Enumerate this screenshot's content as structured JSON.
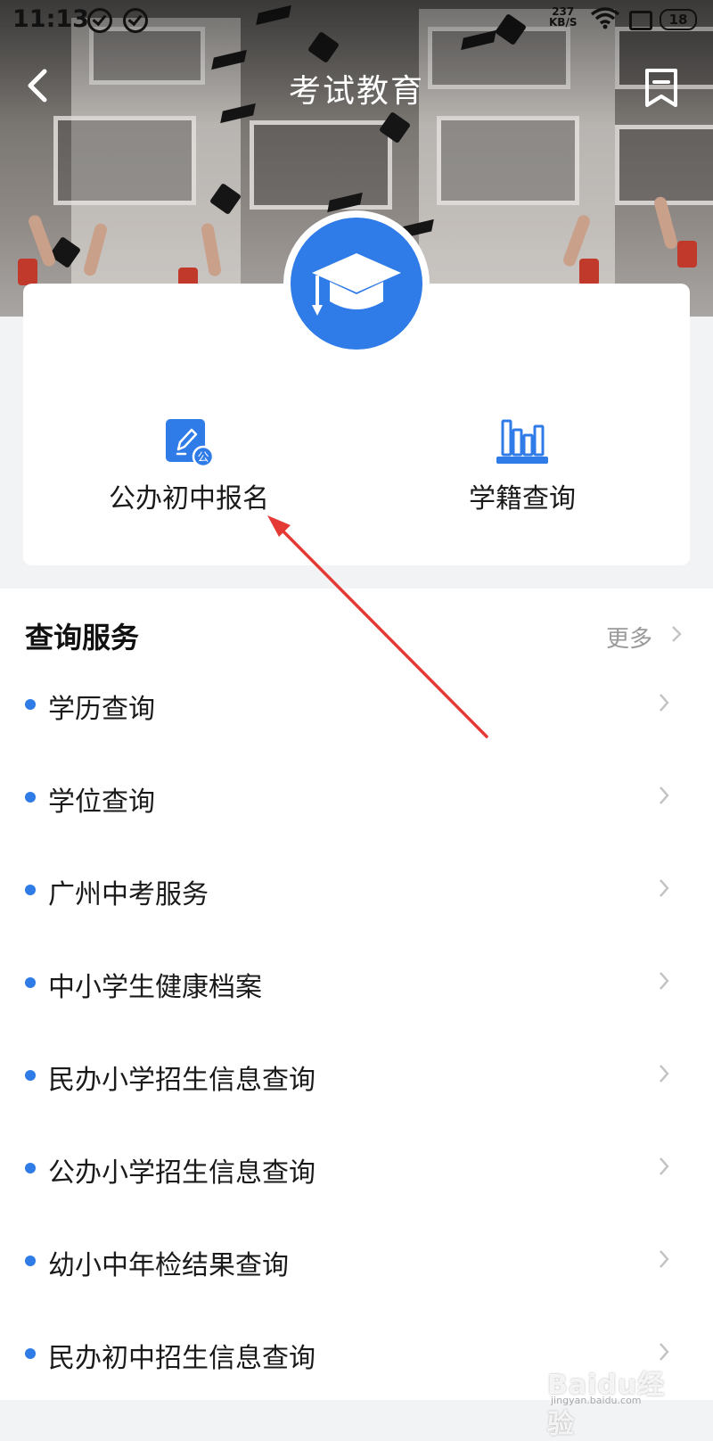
{
  "status_bar": {
    "time": "11:13",
    "net_speed_value": "237",
    "net_speed_unit": "KB/S",
    "battery": "18"
  },
  "header": {
    "title": "考试教育"
  },
  "featured": {
    "items": [
      {
        "label": "公办初中报名",
        "icon": "edit-document-icon",
        "badge": "公"
      },
      {
        "label": "学籍查询",
        "icon": "books-icon"
      }
    ]
  },
  "query_section": {
    "title": "查询服务",
    "more_label": "更多",
    "items": [
      {
        "label": "学历查询"
      },
      {
        "label": "学位查询"
      },
      {
        "label": "广州中考服务"
      },
      {
        "label": "中小学生健康档案"
      },
      {
        "label": "民办小学招生信息查询"
      },
      {
        "label": "公办小学招生信息查询"
      },
      {
        "label": "幼小中年检结果查询"
      },
      {
        "label": "民办初中招生信息查询"
      }
    ]
  },
  "watermark": {
    "brand": "Baidu经验",
    "url": "jingyan.baidu.com"
  },
  "colors": {
    "accent": "#2f7be8",
    "annotation_arrow": "#e53935"
  }
}
